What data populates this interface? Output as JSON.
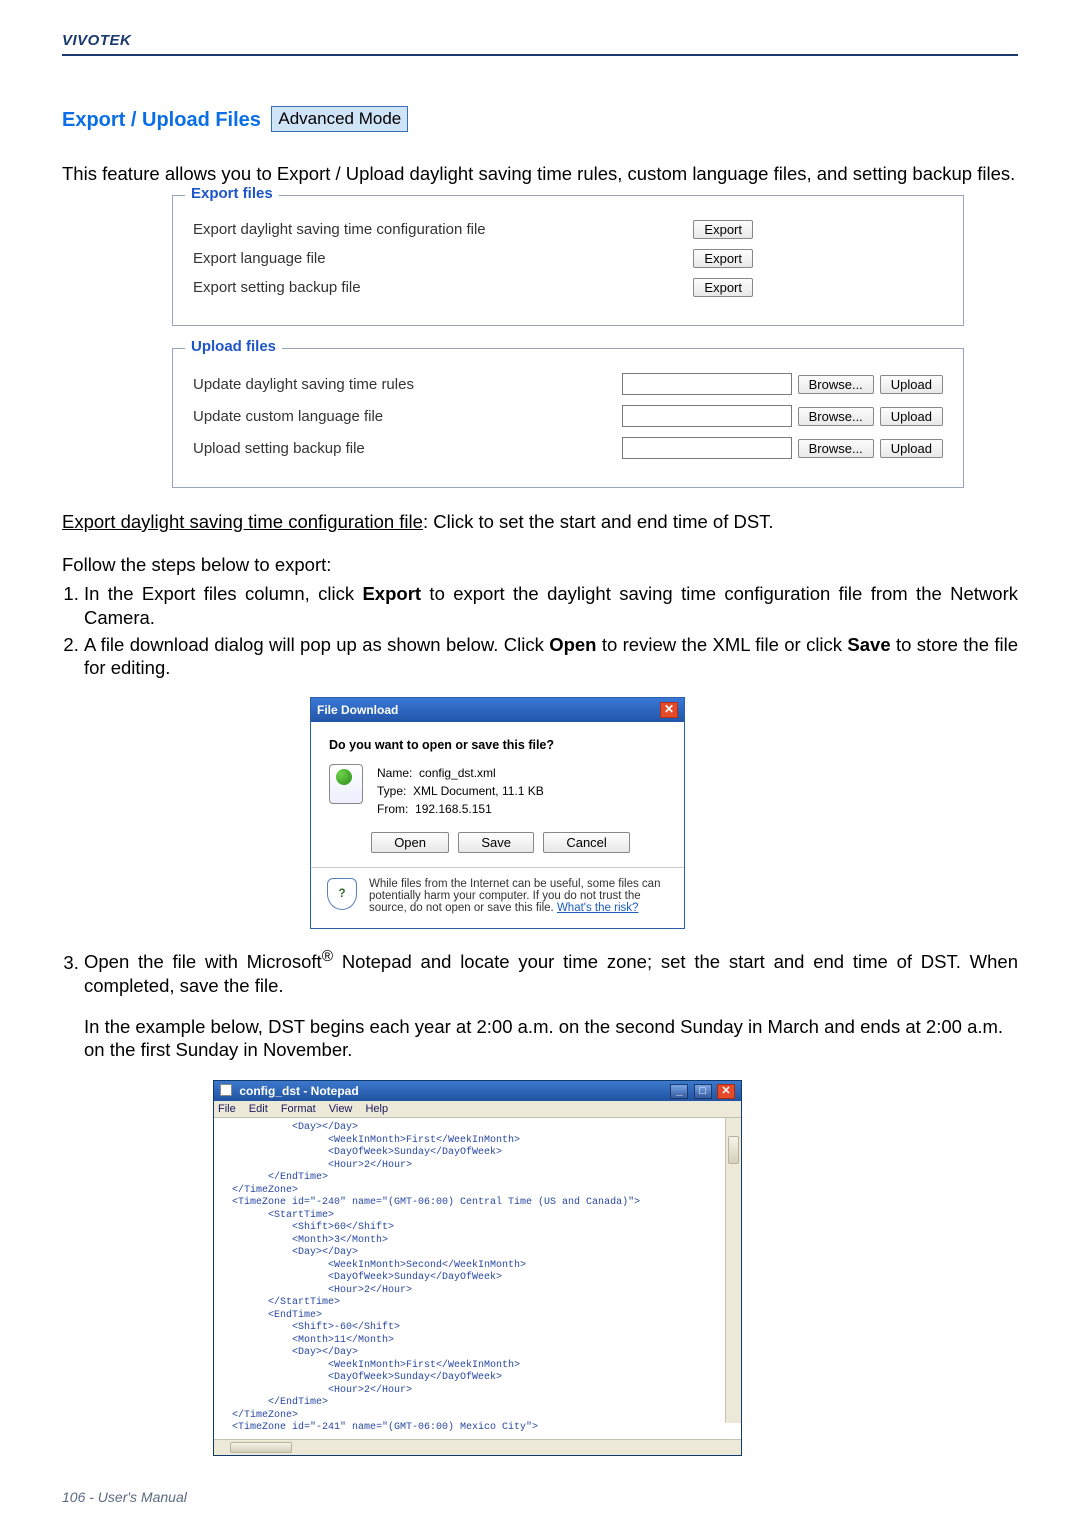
{
  "brand": "VIVOTEK",
  "heading": "Export / Upload Files",
  "mode_badge": "Advanced Mode",
  "intro": "This feature allows you to Export / Upload daylight saving time rules, custom language files, and setting backup files.",
  "export_panel": {
    "legend": "Export files",
    "rows": [
      {
        "label": "Export daylight saving time configuration file",
        "btn": "Export"
      },
      {
        "label": "Export language file",
        "btn": "Export"
      },
      {
        "label": "Export setting backup file",
        "btn": "Export"
      }
    ]
  },
  "upload_panel": {
    "legend": "Upload files",
    "rows": [
      {
        "label": "Update daylight saving time rules",
        "browse": "Browse...",
        "btn": "Upload"
      },
      {
        "label": "Update custom language file",
        "browse": "Browse...",
        "btn": "Upload"
      },
      {
        "label": "Upload setting backup file",
        "browse": "Browse...",
        "btn": "Upload"
      }
    ]
  },
  "instr_underline": "Export daylight saving time configuration file",
  "instr_rest": ": Click to set the start and end time of DST.",
  "follow_steps": "Follow the steps below to export:",
  "steps_1a": "In the Export files column, click ",
  "steps_1b": "Export",
  "steps_1c": " to export the daylight saving time configuration file from the Network Camera.",
  "steps_2a": "A file download dialog will pop up as shown below. Click ",
  "steps_2b": "Open",
  "steps_2c": " to review the XML file or click ",
  "steps_2d": "Save",
  "steps_2e": " to store the file for editing.",
  "dlg": {
    "title": "File Download",
    "question": "Do you want to open or save this file?",
    "name_label": "Name:",
    "name_value": "config_dst.xml",
    "type_label": "Type:",
    "type_value": "XML Document, 11.1 KB",
    "from_label": "From:",
    "from_value": "192.168.5.151",
    "btn_open": "Open",
    "btn_save": "Save",
    "btn_cancel": "Cancel",
    "foot_text": "While files from the Internet can be useful, some files can potentially harm your computer. If you do not trust the source, do not open or save this file. ",
    "foot_link": "What's the risk?"
  },
  "steps_3a": "Open the file with Microsoft",
  "steps_3b": "®",
  "steps_3c": " Notepad and locate your time zone; set the start and end time of DST. When completed, save the file.",
  "example_text": "In the example below, DST begins each year at 2:00 a.m. on the second Sunday in March and ends at 2:00 a.m. on the first Sunday in November.",
  "notepad": {
    "title": "config_dst - Notepad",
    "menu": [
      "File",
      "Edit",
      "Format",
      "View",
      "Help"
    ],
    "content": "            <Day></Day>\n                  <WeekInMonth>First</WeekInMonth>\n                  <DayOfWeek>Sunday</DayOfWeek>\n                  <Hour>2</Hour>\n        </EndTime>\n  </TimeZone>\n  <TimeZone id=\"-240\" name=\"(GMT-06:00) Central Time (US and Canada)\">\n        <StartTime>\n            <Shift>60</Shift>\n            <Month>3</Month>\n            <Day></Day>\n                  <WeekInMonth>Second</WeekInMonth>\n                  <DayOfWeek>Sunday</DayOfWeek>\n                  <Hour>2</Hour>\n        </StartTime>\n        <EndTime>\n            <Shift>-60</Shift>\n            <Month>11</Month>\n            <Day></Day>\n                  <WeekInMonth>First</WeekInMonth>\n                  <DayOfWeek>Sunday</DayOfWeek>\n                  <Hour>2</Hour>\n        </EndTime>\n  </TimeZone>\n  <TimeZone id=\"-241\" name=\"(GMT-06:00) Mexico City\">"
  },
  "footer": "106 - User's Manual"
}
